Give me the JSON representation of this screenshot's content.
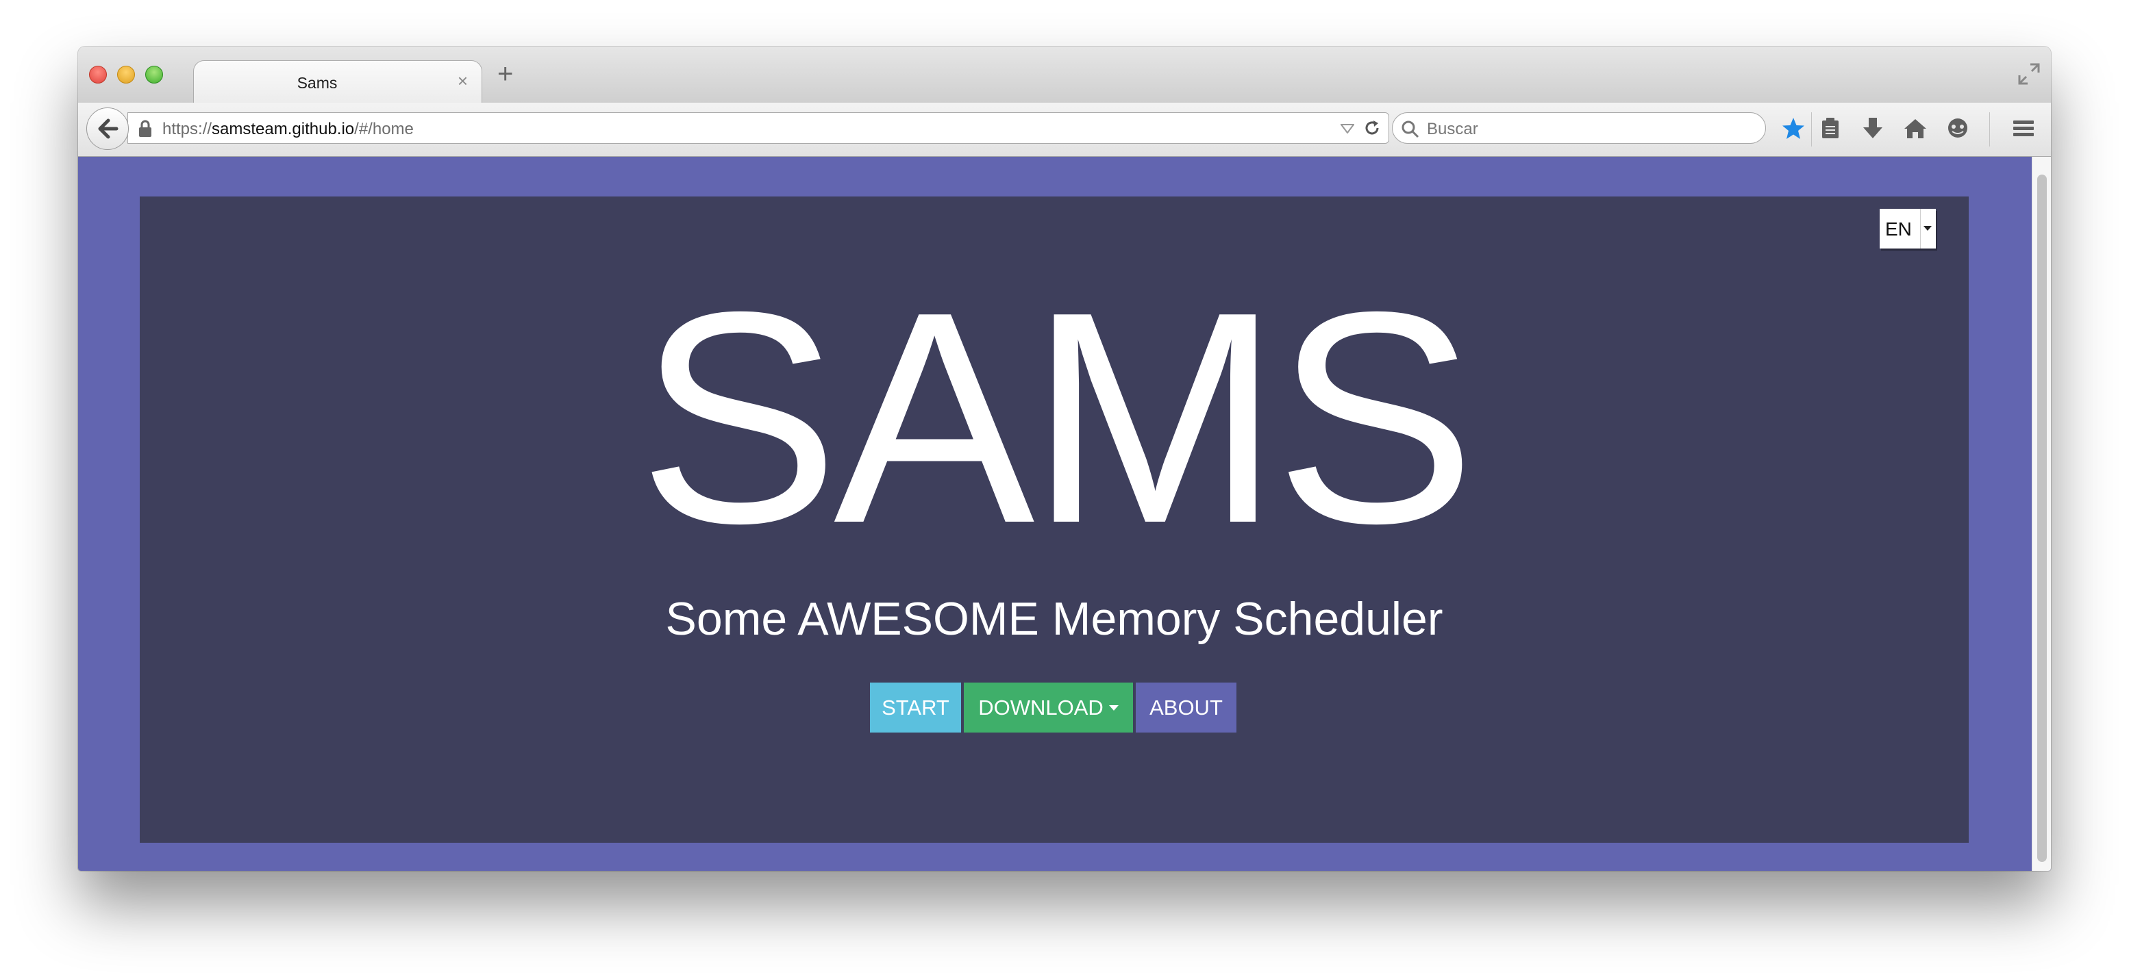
{
  "browser": {
    "tab_title": "Sams",
    "tab_close_glyph": "×",
    "new_tab_glyph": "+",
    "url_scheme": "https://",
    "url_host": "samsteam.github.io",
    "url_path": "/#/home",
    "search_placeholder": "Buscar",
    "toolbar_icons": [
      "back-arrow-icon",
      "lock-icon",
      "bookmark-star-icon",
      "reading-list-icon",
      "download-icon",
      "home-icon",
      "chat-icon",
      "hamburger-menu-icon"
    ],
    "accent_star_color": "#1e88e5"
  },
  "page": {
    "background_color": "#6265b0",
    "panel_color": "#3e3f5c",
    "language_selector": {
      "value": "EN"
    },
    "title": "SAMS",
    "subtitle": "Some AWESOME Memory Scheduler",
    "buttons": {
      "start": {
        "label": "START",
        "color": "#5bc0de"
      },
      "download": {
        "label": "DOWNLOAD",
        "color": "#3faf6a"
      },
      "about": {
        "label": "ABOUT",
        "color": "#6265b0"
      }
    }
  }
}
